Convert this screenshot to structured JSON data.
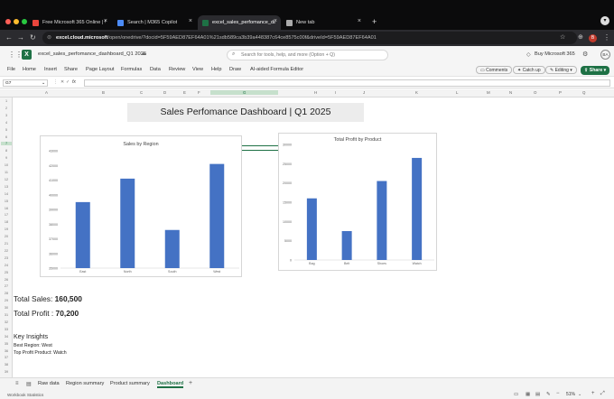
{
  "browser": {
    "tabs": [
      {
        "label": "Free Microsoft 365 Online | W",
        "color": "#e8453c"
      },
      {
        "label": "Search | M365 Copilot",
        "color": "#4c8bf5"
      },
      {
        "label": "excel_sales_perfomance_da",
        "color": "#1e7145"
      },
      {
        "label": "New tab",
        "color": "#aaaaaa"
      }
    ],
    "url_domain": "excel.cloud.microsoft",
    "url_path": "/open/onedrive/?docid=5F59AED87EF64A01%21sdb589ca3b39a448387c64ce8575c00f&driveId=5F59AED87EF64A01"
  },
  "app": {
    "file_name": "excel_sales_perfomance_dashboard_Q1 2025",
    "search_placeholder": "Search for tools, help, and more (Option + Q)",
    "buy_label": "Buy Microsoft 365",
    "avatar_initials": "BA"
  },
  "ribbon": {
    "menus": [
      "File",
      "Home",
      "Insert",
      "Share",
      "Page Layout",
      "Formulas",
      "Data",
      "Review",
      "View",
      "Help",
      "Draw",
      "AI-aided Formula Editor"
    ],
    "comments": "Comments",
    "catch_up": "Catch up",
    "editing": "Editing",
    "share": "Share"
  },
  "formula_bar": {
    "cell_ref": "G7",
    "fx": "fx",
    "value": ""
  },
  "columns": [
    "A",
    "B",
    "C",
    "D",
    "E",
    "F",
    "G",
    "H",
    "I",
    "J",
    "K",
    "L",
    "M",
    "N",
    "O",
    "P",
    "Q"
  ],
  "rows": [
    "1",
    "2",
    "3",
    "4",
    "5",
    "6",
    "7",
    "8",
    "9",
    "10",
    "11",
    "12",
    "13",
    "14",
    "15",
    "16",
    "17",
    "18",
    "19",
    "20",
    "21",
    "22",
    "23",
    "24",
    "25",
    "26",
    "27",
    "28",
    "29",
    "30",
    "31",
    "32",
    "33",
    "34",
    "35",
    "36",
    "37",
    "38",
    "39"
  ],
  "sheet": {
    "dashboard_title": "Sales Perfomance Dashboard | Q1 2025",
    "total_sales_label": "Total Sales: ",
    "total_sales_value": "160,500",
    "total_profit_label": "Total Profit : ",
    "total_profit_value": "70,200",
    "key_insights": "Key Insights",
    "best_region_label": "Best Region: ",
    "best_region_value": "West",
    "top_product_label": "Top Profit Product: ",
    "top_product_value": "Watch"
  },
  "chart_data": [
    {
      "type": "bar",
      "title": "Sales by Region",
      "categories": [
        "East",
        "North",
        "South",
        "West"
      ],
      "values": [
        39500,
        41100,
        37600,
        42100
      ],
      "ylim": [
        35000,
        43000
      ],
      "yticks": [
        "35000",
        "36000",
        "37000",
        "38000",
        "39000",
        "40000",
        "41000",
        "42000",
        "43000"
      ],
      "grid": false,
      "color": "#4472c4"
    },
    {
      "type": "bar",
      "title": "Total Profit by Product",
      "categories": [
        "Bag",
        "Belt",
        "Shoes",
        "Watch"
      ],
      "values": [
        16000,
        7500,
        20500,
        26500
      ],
      "ylim": [
        0,
        30000
      ],
      "yticks": [
        "0",
        "5000",
        "10000",
        "15000",
        "20000",
        "25000",
        "30000"
      ],
      "grid": false,
      "color": "#4472c4"
    }
  ],
  "sheet_tabs": [
    "Raw data",
    "Region summary",
    "Product summary",
    "Dashboard"
  ],
  "active_sheet": "Dashboard",
  "status": {
    "left": "Workbook Statistics",
    "zoom": "51%"
  }
}
